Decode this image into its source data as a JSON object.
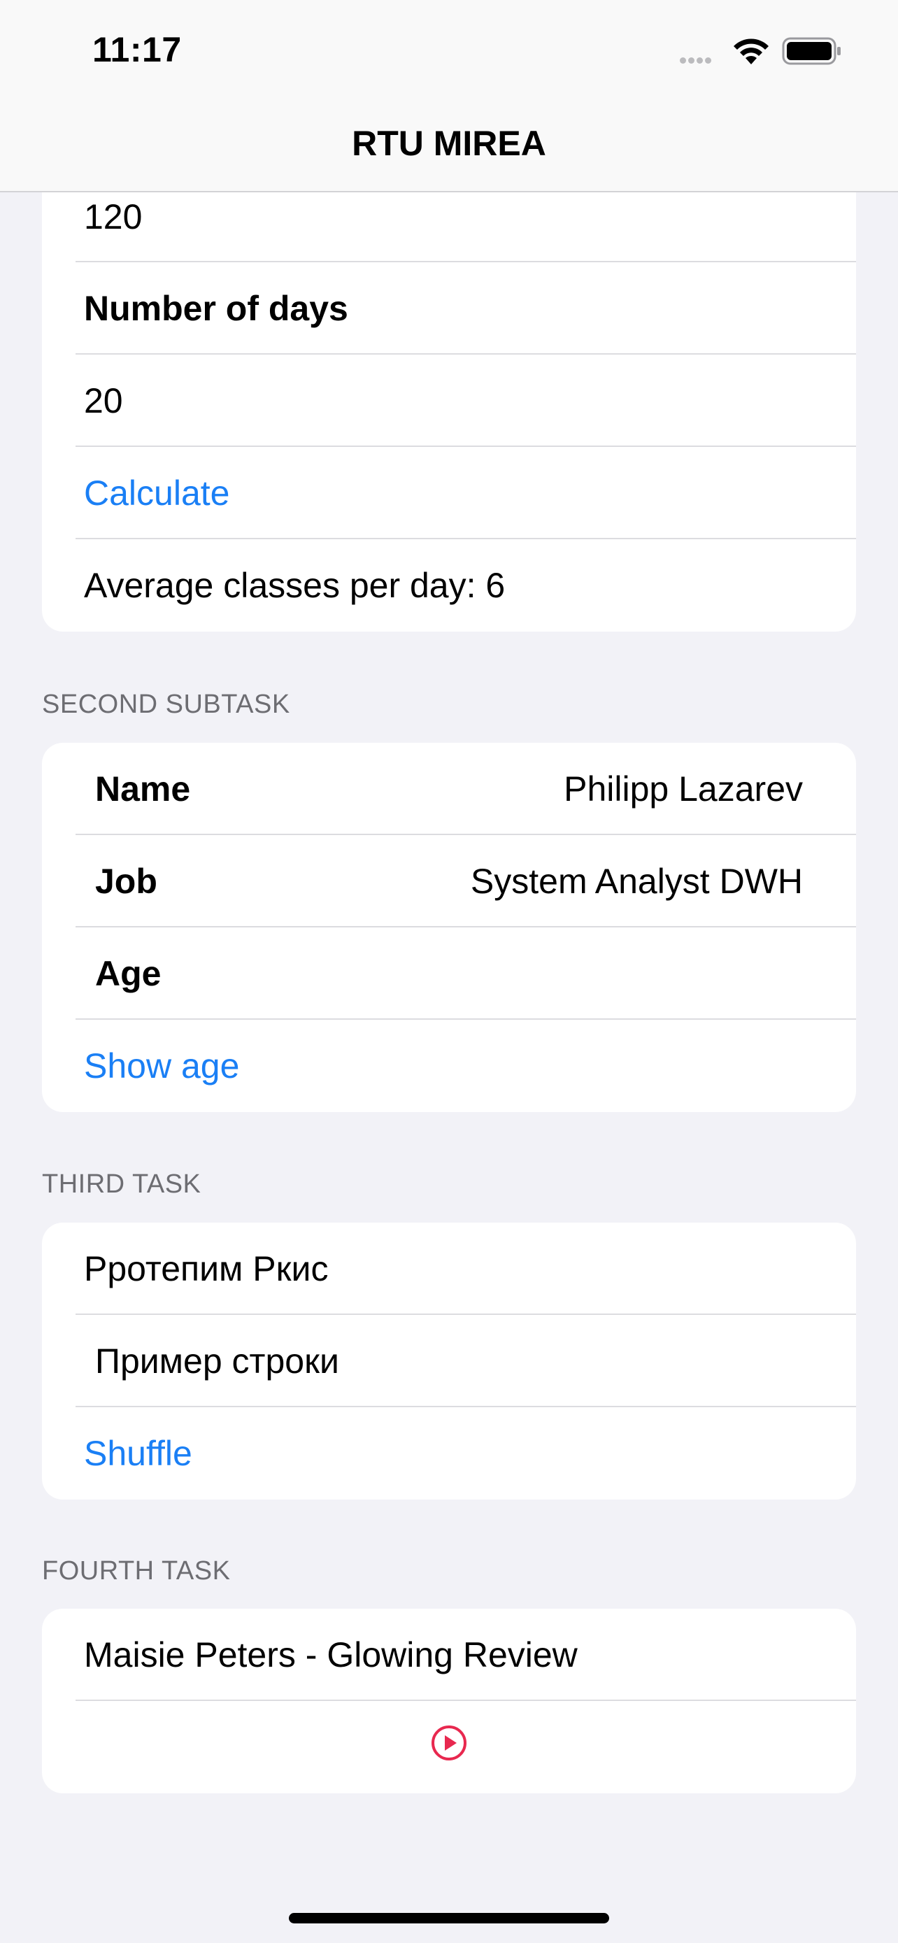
{
  "status_bar": {
    "time": "11:17"
  },
  "nav": {
    "title": "RTU MIREA"
  },
  "first_card": {
    "value1": "120",
    "days_label": "Number of days",
    "days_value": "20",
    "calculate": "Calculate",
    "result": "Average classes per day: 6"
  },
  "second": {
    "header": "SECOND SUBTASK",
    "name_label": "Name",
    "name_value": "Philipp Lazarev",
    "job_label": "Job",
    "job_value": "System Analyst DWH",
    "age_label": "Age",
    "show_age": "Show age"
  },
  "third": {
    "header": "THIRD TASK",
    "line1": "Рротепим Ркис",
    "line2": "Пример строки",
    "shuffle": "Shuffle"
  },
  "fourth": {
    "header": "FOURTH TASK",
    "song": "Maisie Peters - Glowing Review",
    "play_icon": "play-circle-icon"
  },
  "colors": {
    "accent": "#1a7ff5",
    "play": "#e8284f",
    "background": "#f2f2f7"
  }
}
